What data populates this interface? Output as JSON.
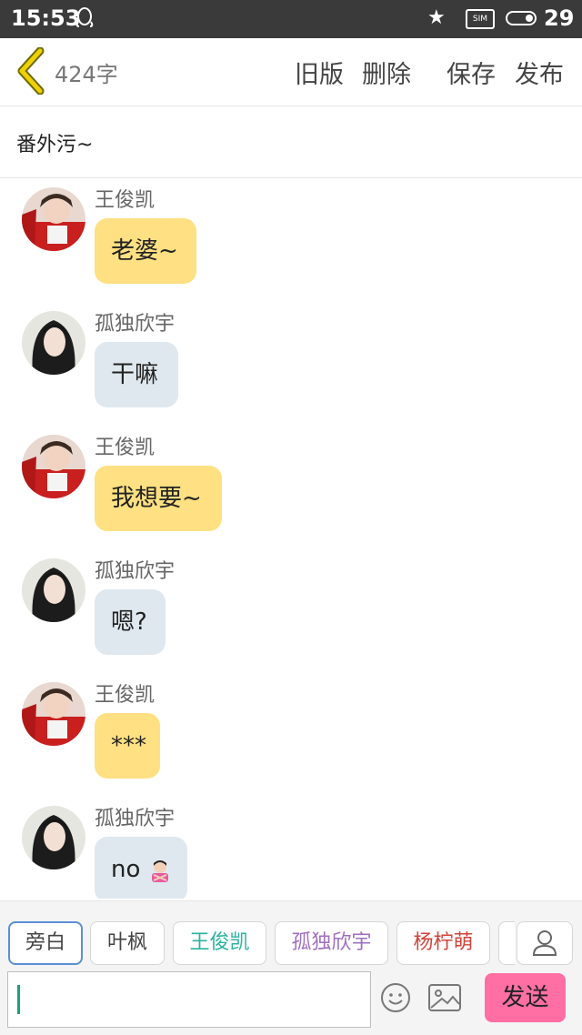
{
  "status_bar": {
    "time": "15:53",
    "sim_label": "SIM",
    "battery_level": "29"
  },
  "toolbar": {
    "word_count": "424字",
    "old_version": "旧版",
    "delete": "删除",
    "save": "保存",
    "publish": "发布"
  },
  "story": {
    "title": "番外污~"
  },
  "messages": [
    {
      "sender": "王俊凯",
      "text": "老婆~",
      "side": "yellow"
    },
    {
      "sender": "孤独欣宇",
      "text": "干嘛",
      "side": "blue"
    },
    {
      "sender": "王俊凯",
      "text": "我想要~",
      "side": "yellow"
    },
    {
      "sender": "孤独欣宇",
      "text": "嗯?",
      "side": "blue"
    },
    {
      "sender": "王俊凯",
      "text": "***",
      "side": "yellow"
    },
    {
      "sender": "孤独欣宇",
      "text": "no",
      "side": "blue"
    }
  ],
  "roles": [
    {
      "label": "旁白",
      "color": "#444444",
      "selected": true
    },
    {
      "label": "叶枫",
      "color": "#444444"
    },
    {
      "label": "王俊凯",
      "color": "#2bb3a0"
    },
    {
      "label": "孤独欣宇",
      "color": "#a070c0"
    },
    {
      "label": "杨柠萌",
      "color": "#d0443a"
    }
  ],
  "composer": {
    "input_value": "",
    "send": "发送"
  },
  "icons": {
    "back": "chevron-left-icon",
    "person": "person-icon",
    "emoji": "smile-icon",
    "image": "image-icon"
  },
  "colors": {
    "accent_yellow": "#ffe082",
    "bubble_blue": "#dfe8ef",
    "send_pink": "#ff6fa3"
  }
}
